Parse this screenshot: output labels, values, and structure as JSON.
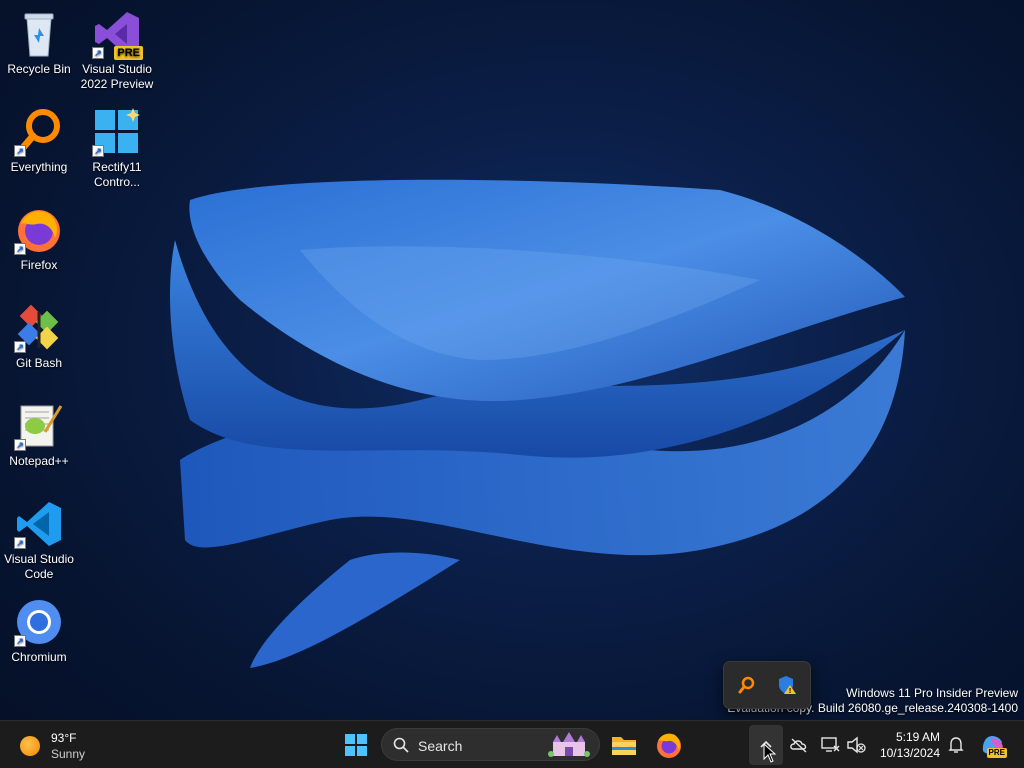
{
  "desktop": {
    "icons": [
      {
        "label": "Recycle Bin"
      },
      {
        "label": "Visual Studio 2022 Preview",
        "badge": "PRE"
      },
      {
        "label": "Everything"
      },
      {
        "label": "Rectify11 Contro..."
      },
      {
        "label": "Firefox"
      },
      {
        "label": "Git Bash"
      },
      {
        "label": "Notepad++"
      },
      {
        "label": "Visual Studio Code"
      },
      {
        "label": "Chromium"
      }
    ]
  },
  "watermark": {
    "line1": "Windows 11 Pro Insider Preview",
    "line2": "Evaluation copy. Build 26080.ge_release.240308-1400"
  },
  "tray_popup": {
    "items": [
      {
        "icon": "everything-search-icon"
      },
      {
        "icon": "defender-warning-icon"
      }
    ]
  },
  "taskbar": {
    "weather": {
      "temp": "93°F",
      "condition": "Sunny"
    },
    "search": {
      "placeholder": "Search"
    },
    "apps": [
      "windows-start-icon",
      "file-explorer-icon",
      "firefox-icon"
    ],
    "tray_icons": [
      "chevron-up-icon",
      "onedrive-off-icon",
      "network-icon",
      "speaker-muted-icon"
    ],
    "clock": {
      "time": "5:19 AM",
      "date": "10/13/2024"
    },
    "badge": "PRE"
  },
  "colors": {
    "accent": "#1a73e8",
    "taskbar": "#1c1c1c",
    "desktop": "#0b1f49"
  }
}
